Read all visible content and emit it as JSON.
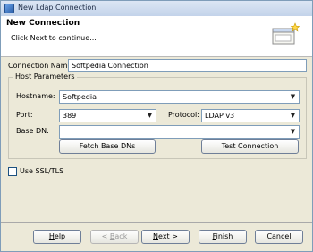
{
  "window": {
    "title": "New Ldap Connection"
  },
  "header": {
    "title": "New Connection",
    "subtitle": "Click Next to continue..."
  },
  "connection": {
    "label": "Connection Name:",
    "value": "Softpedia Connection"
  },
  "host_params": {
    "group_title": "Host Parameters",
    "hostname": {
      "label": "Hostname:",
      "value": "Softpedia"
    },
    "port": {
      "label": "Port:",
      "value": "389"
    },
    "protocol": {
      "label": "Protocol:",
      "value": "LDAP v3"
    },
    "base_dn": {
      "label": "Base DN:",
      "value": ""
    },
    "fetch_button": "Fetch Base DNs",
    "test_button": "Test Connection"
  },
  "ssl": {
    "label": "Use SSL/TLS",
    "checked": false
  },
  "footer": {
    "help": {
      "mnemonic": "H",
      "rest": "elp"
    },
    "back": {
      "prefix": "< ",
      "mnemonic": "B",
      "rest": "ack"
    },
    "next": {
      "mnemonic": "N",
      "rest": "ext >"
    },
    "finish": {
      "mnemonic": "F",
      "rest": "inish"
    },
    "cancel": "Cancel"
  }
}
